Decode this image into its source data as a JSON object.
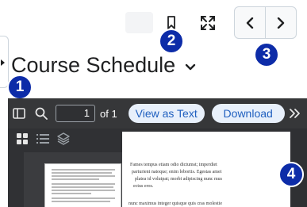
{
  "title": "Course Schedule",
  "nav": {
    "prev_label": "Previous",
    "next_label": "Next"
  },
  "badges": [
    "1",
    "2",
    "3",
    "4"
  ],
  "viewer": {
    "page_number": "1",
    "page_total": "of 1",
    "view_as_text": "View as Text",
    "download": "Download",
    "body_lines": [
      "Fames tempus etiam odio dictumst; imperdiet",
      "parturient natoque; enim lobortis. Egestas amet",
      "platea id volutpat; morbi adipiscing nunc mus",
      "ectus eros.",
      "nunc maximus integer quisque quis cras molestie"
    ]
  },
  "colors": {
    "badge": "#0d2ca8",
    "viewer_bg": "#2f3033",
    "pill_text": "#1f5fbf"
  },
  "icons": [
    "bookmark-icon",
    "fullscreen-icon",
    "chevron-left-icon",
    "chevron-right-icon",
    "chevron-down-icon",
    "sidebar-toggle-icon",
    "search-icon",
    "more-icon",
    "thumbnails-icon",
    "outline-icon",
    "layers-icon"
  ]
}
